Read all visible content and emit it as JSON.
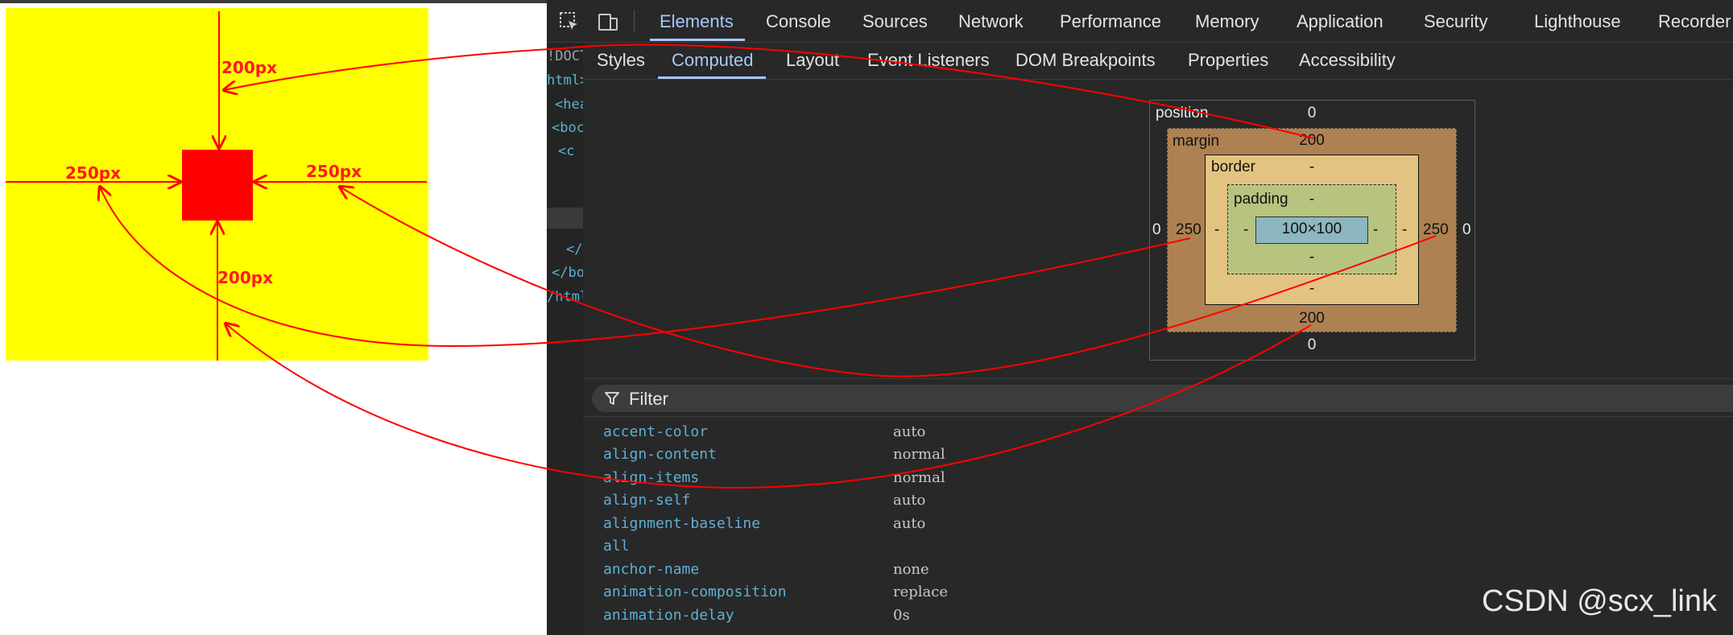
{
  "page": {
    "margin_top_label": "200px",
    "margin_left_label": "250px",
    "margin_right_label": "250px",
    "margin_bottom_label": "200px",
    "colors": {
      "container": "#ffff00",
      "box": "#ff0000",
      "annotation": "#ff0000"
    }
  },
  "devtools": {
    "main_tabs": [
      "Elements",
      "Console",
      "Sources",
      "Network",
      "Performance",
      "Memory",
      "Application",
      "Security",
      "Lighthouse",
      "Recorder"
    ],
    "active_main_tab": "Elements",
    "sub_tabs": [
      "Styles",
      "Computed",
      "Layout",
      "Event Listeners",
      "DOM Breakpoints",
      "Properties",
      "Accessibility"
    ],
    "active_sub_tab": "Computed",
    "dom_tree": [
      "!DOCT",
      "html>",
      "<hea",
      "<boc",
      "<c",
      "</",
      "</bo",
      "/html"
    ],
    "box_model": {
      "position_label": "position",
      "position_top": "0",
      "position_right": "0",
      "position_bottom": "0",
      "position_left": "0",
      "margin_label": "margin",
      "margin_top": "200",
      "margin_right": "250",
      "margin_bottom": "200",
      "margin_left": "250",
      "border_label": "border",
      "border_top": "-",
      "border_right": "-",
      "border_bottom": "-",
      "border_left": "-",
      "padding_label": "padding",
      "padding_top": "-",
      "padding_right": "-",
      "padding_bottom": "-",
      "padding_left": "-",
      "content": "100×100"
    },
    "filter_label": "Filter",
    "properties": [
      {
        "name": "accent-color",
        "value": "auto"
      },
      {
        "name": "align-content",
        "value": "normal"
      },
      {
        "name": "align-items",
        "value": "normal"
      },
      {
        "name": "align-self",
        "value": "auto"
      },
      {
        "name": "alignment-baseline",
        "value": "auto"
      },
      {
        "name": "all",
        "value": ""
      },
      {
        "name": "anchor-name",
        "value": "none"
      },
      {
        "name": "animation-composition",
        "value": "replace"
      },
      {
        "name": "animation-delay",
        "value": "0s"
      }
    ]
  },
  "watermark": "CSDN @scx_link"
}
